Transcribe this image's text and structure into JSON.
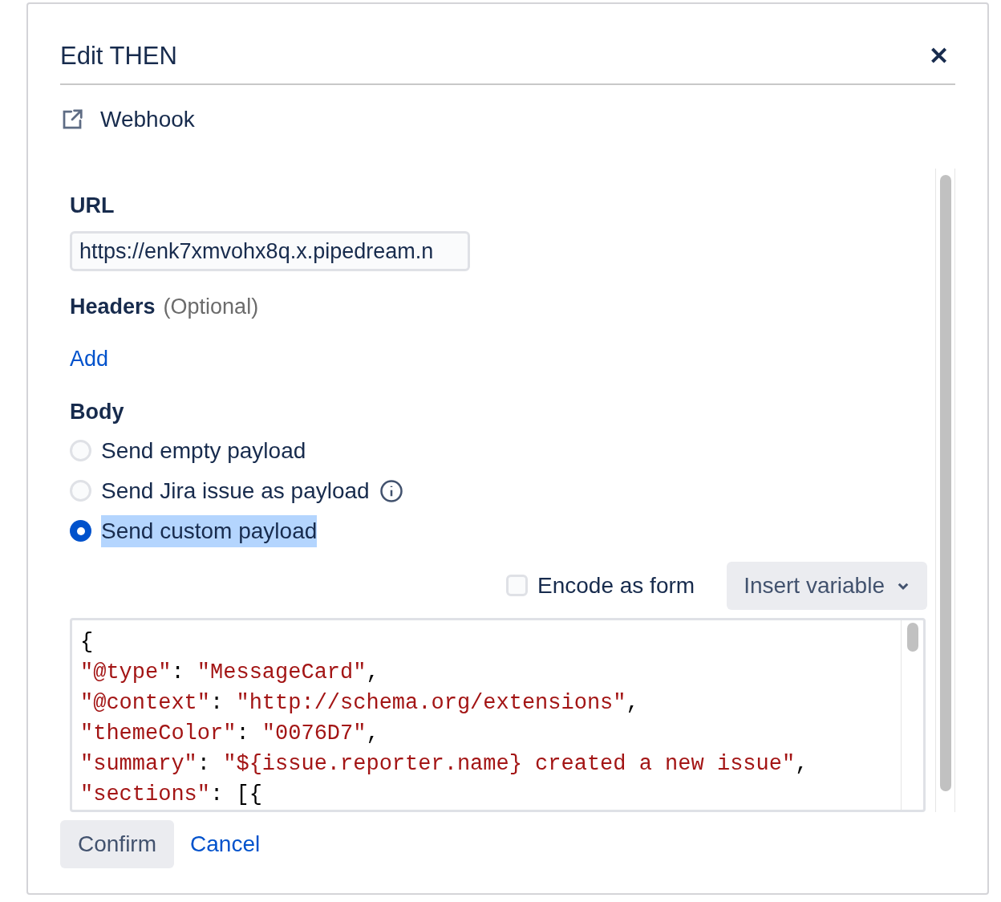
{
  "dialog": {
    "title": "Edit THEN",
    "close_label": "✕"
  },
  "action": {
    "label": "Webhook"
  },
  "url": {
    "label": "URL",
    "value": "https://enk7xmvohx8q.x.pipedream.n"
  },
  "headers": {
    "label": "Headers",
    "hint": "(Optional)",
    "add_link": "Add"
  },
  "body": {
    "label": "Body",
    "options": [
      {
        "label": "Send empty payload",
        "selected": false,
        "info": false,
        "highlighted": false
      },
      {
        "label": "Send Jira issue as payload",
        "selected": false,
        "info": true,
        "highlighted": false
      },
      {
        "label": "Send custom payload",
        "selected": true,
        "info": false,
        "highlighted": true
      }
    ]
  },
  "encode": {
    "label": "Encode as form",
    "checked": false
  },
  "insert_variable": {
    "label": "Insert variable"
  },
  "code_lines": [
    [
      {
        "kind": "punct",
        "text": "{"
      }
    ],
    [
      {
        "kind": "string",
        "text": "\"@type\""
      },
      {
        "kind": "punct",
        "text": ": "
      },
      {
        "kind": "string",
        "text": "\"MessageCard\""
      },
      {
        "kind": "punct",
        "text": ","
      }
    ],
    [
      {
        "kind": "string",
        "text": "\"@context\""
      },
      {
        "kind": "punct",
        "text": ": "
      },
      {
        "kind": "string",
        "text": "\"http://schema.org/extensions\""
      },
      {
        "kind": "punct",
        "text": ","
      }
    ],
    [
      {
        "kind": "string",
        "text": "\"themeColor\""
      },
      {
        "kind": "punct",
        "text": ": "
      },
      {
        "kind": "string",
        "text": "\"0076D7\""
      },
      {
        "kind": "punct",
        "text": ","
      }
    ],
    [
      {
        "kind": "string",
        "text": "\"summary\""
      },
      {
        "kind": "punct",
        "text": ": "
      },
      {
        "kind": "string",
        "text": "\"${issue.reporter.name} created a new issue\""
      },
      {
        "kind": "punct",
        "text": ","
      }
    ],
    [
      {
        "kind": "string",
        "text": "\"sections\""
      },
      {
        "kind": "punct",
        "text": ": [{"
      }
    ]
  ],
  "footer": {
    "confirm": "Confirm",
    "cancel": "Cancel"
  }
}
